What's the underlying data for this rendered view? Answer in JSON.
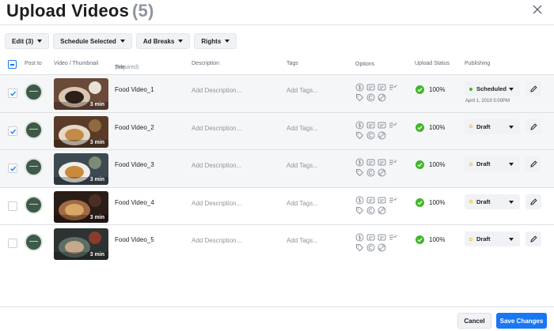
{
  "header": {
    "title": "Upload Videos",
    "count": "(5)"
  },
  "toolbar": {
    "edit_label": "Edit (3)",
    "schedule_label": "Schedule Selected",
    "ad_breaks_label": "Ad Breaks",
    "rights_label": "Rights"
  },
  "columns": {
    "post_to": "Post to",
    "video": "Video / Thumbnail",
    "title": "Title",
    "title_note": "(required)",
    "description": "Description",
    "tags": "Tags",
    "options": "Options",
    "upload_status": "Upload Status",
    "publishing": "Publishing"
  },
  "rows": [
    {
      "selected": true,
      "title": "Food Video_1",
      "duration": "3 min",
      "description": "Add Description...",
      "tags": "Add Tags...",
      "upload": "100%",
      "publish": "Scheduled",
      "publish_date": "April 1, 2019  5:00PM"
    },
    {
      "selected": true,
      "title": "Food Video_2",
      "duration": "3 min",
      "description": "Add Description...",
      "tags": "Add Tags...",
      "upload": "100%",
      "publish": "Draft"
    },
    {
      "selected": true,
      "title": "Food Video_3",
      "duration": "3 min",
      "description": "Add Description...",
      "tags": "Add Tags...",
      "upload": "100%",
      "publish": "Draft"
    },
    {
      "selected": false,
      "title": "Food Video_4",
      "duration": "3 min",
      "description": "Add Description...",
      "tags": "Add Tags...",
      "upload": "100%",
      "publish": "Draft"
    },
    {
      "selected": false,
      "title": "Food Video_5",
      "duration": "3 min",
      "description": "Add Description...",
      "tags": "Add Tags...",
      "upload": "100%",
      "publish": "Draft"
    }
  ],
  "footer": {
    "cancel_label": "Cancel",
    "save_label": "Save Changes"
  },
  "colors": {
    "accent": "#1877f2",
    "success": "#42b72a",
    "scheduled": "#42b72a",
    "draft": "#f7b928"
  }
}
